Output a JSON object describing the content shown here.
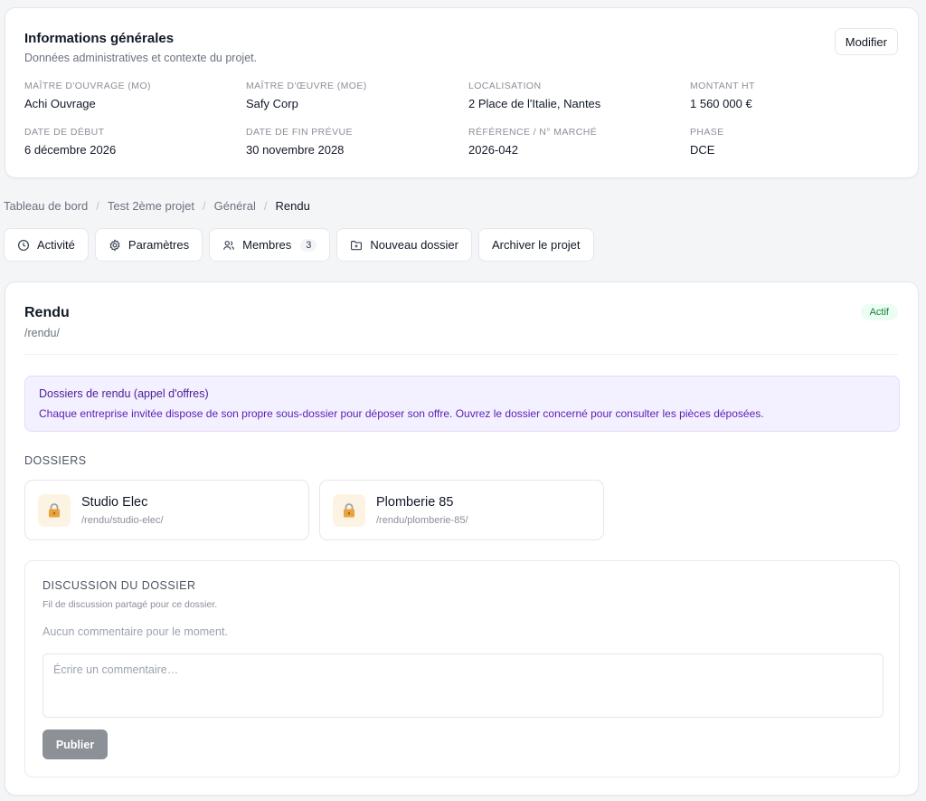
{
  "info": {
    "title": "Informations générales",
    "subtitle": "Données administratives et contexte du projet.",
    "edit_label": "Modifier",
    "fields": [
      {
        "label": "MAÎTRE D'OUVRAGE (MO)",
        "value": "Achi Ouvrage"
      },
      {
        "label": "MAÎTRE D'ŒUVRE (MOE)",
        "value": "Safy Corp"
      },
      {
        "label": "LOCALISATION",
        "value": "2 Place de l'Italie, Nantes"
      },
      {
        "label": "MONTANT HT",
        "value": "1 560 000 €"
      },
      {
        "label": "DATE DE DÉBUT",
        "value": "6 décembre 2026"
      },
      {
        "label": "DATE DE FIN PRÉVUE",
        "value": "30 novembre 2028"
      },
      {
        "label": "RÉFÉRENCE / N° MARCHÉ",
        "value": "2026-042"
      },
      {
        "label": "PHASE",
        "value": "DCE"
      }
    ]
  },
  "breadcrumb": [
    "Tableau de bord",
    "Test 2ème projet",
    "Général",
    "Rendu"
  ],
  "actions": {
    "activity": "Activité",
    "settings": "Paramètres",
    "members": "Membres",
    "members_count": "3",
    "new_folder": "Nouveau dossier",
    "archive": "Archiver le projet"
  },
  "folder": {
    "title": "Rendu",
    "path": "/rendu/",
    "status": "Actif",
    "notice_title": "Dossiers de rendu (appel d'offres)",
    "notice_text": "Chaque entreprise invitée dispose de son propre sous-dossier pour déposer son offre. Ouvrez le dossier concerné pour consulter les pièces déposées.",
    "section_label": "DOSSIERS",
    "subfolders": [
      {
        "name": "Studio Elec",
        "path": "/rendu/studio-elec/",
        "icon": "lock-icon"
      },
      {
        "name": "Plomberie 85",
        "path": "/rendu/plomberie-85/",
        "icon": "lock-icon"
      }
    ]
  },
  "discussion": {
    "title": "DISCUSSION DU DOSSIER",
    "subtitle": "Fil de discussion partagé pour ce dossier.",
    "empty": "Aucun commentaire pour le moment.",
    "placeholder": "Écrire un commentaire…",
    "publish_label": "Publier"
  },
  "colors": {
    "status_green": "#15803d",
    "notice_bg": "#f3f0ff",
    "publish_bg": "#8c9097"
  }
}
